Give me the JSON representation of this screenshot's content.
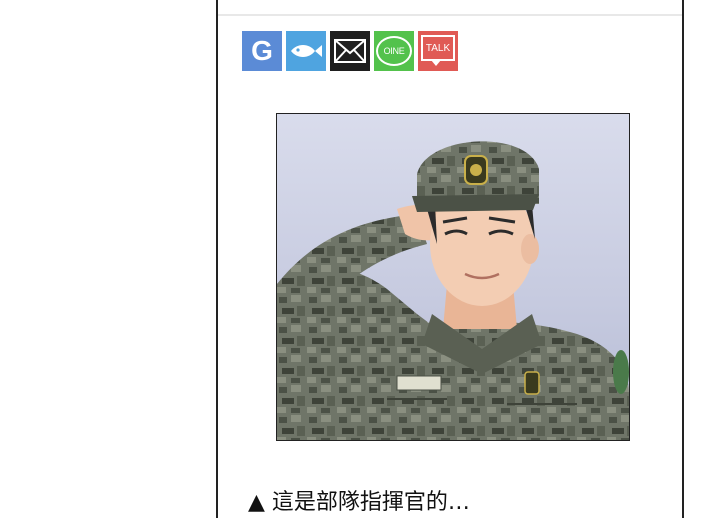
{
  "share": {
    "google_label": "G",
    "line_label": "OINE",
    "talk_label": "TALK"
  },
  "article": {
    "caption": "▲ 這是部隊指揮官的…"
  },
  "comic": {
    "alt": "soldier-saluting-illustration"
  },
  "colors": {
    "google": "#5b8bd6",
    "fish": "#4fa4e0",
    "mail": "#1f1f1f",
    "line": "#53c24c",
    "talk": "#e05a55"
  },
  "icons": [
    "google-icon",
    "fish-icon",
    "mail-icon",
    "line-icon",
    "kakaotalk-icon"
  ]
}
